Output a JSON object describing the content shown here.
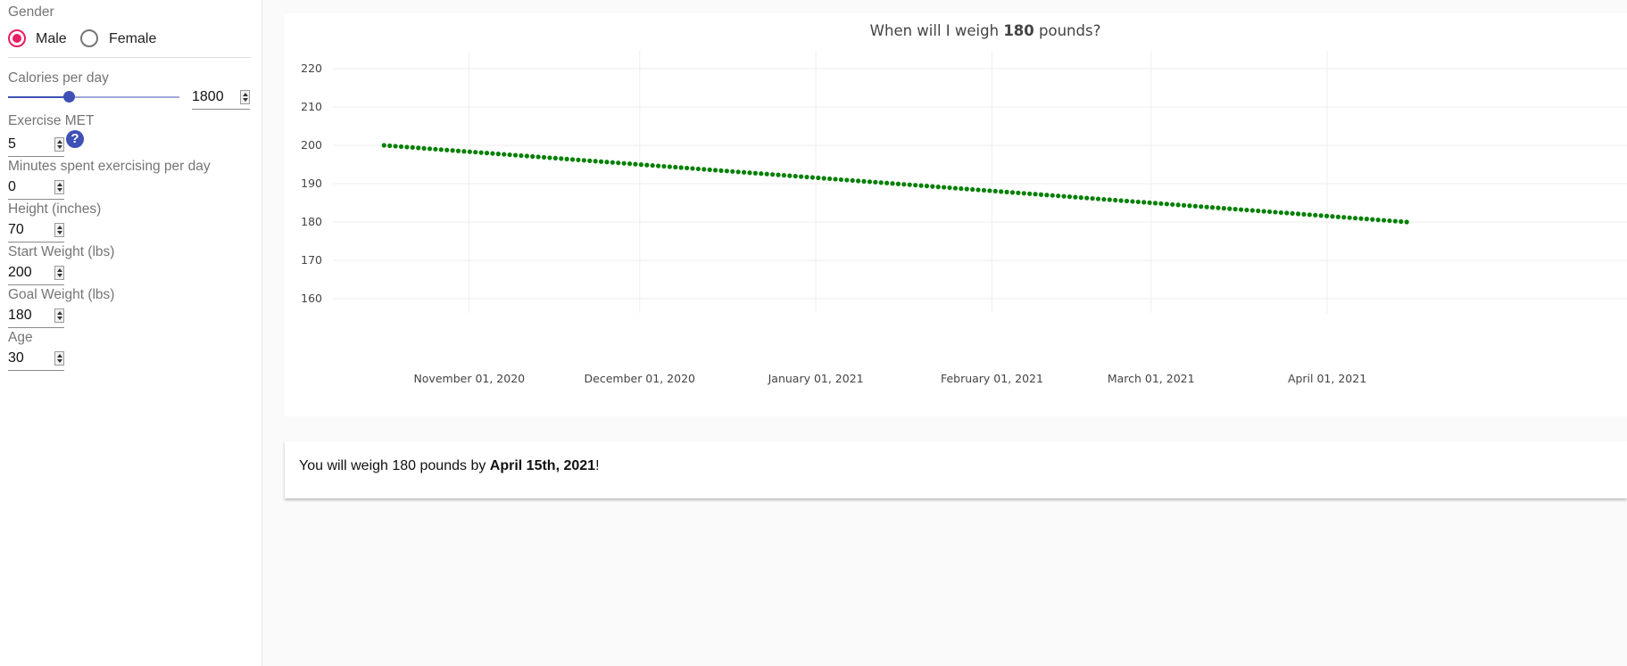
{
  "sidebar": {
    "gender_label": "Gender",
    "gender_options": [
      {
        "label": "Male",
        "selected": true
      },
      {
        "label": "Female",
        "selected": false
      }
    ],
    "calories_label": "Calories per day",
    "calories_value": "1800",
    "calories_slider_fraction": 0.3,
    "exercise_met_label": "Exercise MET",
    "exercise_met_value": "5",
    "help_icon_glyph": "?",
    "minutes_label": "Minutes spent exercising per day",
    "minutes_value": "0",
    "height_label": "Height (inches)",
    "height_value": "70",
    "start_weight_label": "Start Weight (lbs)",
    "start_weight_value": "200",
    "goal_weight_label": "Goal Weight (lbs)",
    "goal_weight_value": "180",
    "age_label": "Age",
    "age_value": "30"
  },
  "chart": {
    "title_prefix": "When will I weigh ",
    "title_bold": "180",
    "title_suffix": " pounds?"
  },
  "result": {
    "prefix": "You will weigh 180 pounds by ",
    "date": "April 15th, 2021",
    "suffix": "!"
  },
  "colors": {
    "accent": "#3f51b5",
    "radio_selected": "#e91e63",
    "series": "#008000"
  },
  "chart_data": {
    "type": "scatter",
    "title": "When will I weigh 180 pounds?",
    "x_start": "2020-10-17",
    "x_end": "2021-04-15",
    "y_start": 200,
    "y_end": 180,
    "point_count": 180,
    "ylim": [
      155,
      225
    ],
    "y_ticks": [
      160,
      170,
      180,
      190,
      200,
      210,
      220
    ],
    "x_ticks": [
      {
        "date": "2020-11-01",
        "label": "November 01, 2020"
      },
      {
        "date": "2020-12-01",
        "label": "December 01, 2020"
      },
      {
        "date": "2021-01-01",
        "label": "January 01, 2021"
      },
      {
        "date": "2021-02-01",
        "label": "February 01, 2021"
      },
      {
        "date": "2021-03-01",
        "label": "March 01, 2021"
      },
      {
        "date": "2021-04-01",
        "label": "April 01, 2021"
      }
    ],
    "grid": true,
    "legend": "none"
  }
}
